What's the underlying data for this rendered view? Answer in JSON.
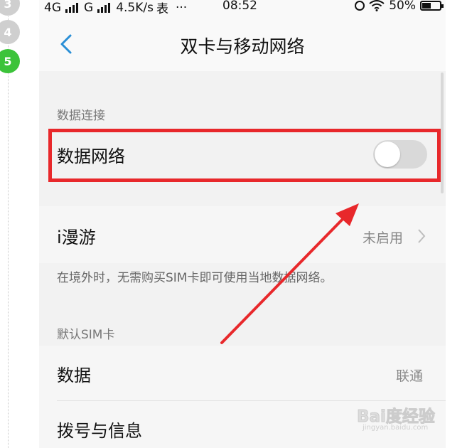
{
  "steps": {
    "s3": "3",
    "s4": "4",
    "s5": "5"
  },
  "status_bar": {
    "sim1": "4G",
    "sim2": "G",
    "speed": "4.5K/s",
    "app_icon": "表",
    "more": "···",
    "time": "08:52",
    "battery": "50%",
    "icons": [
      "alarm-icon",
      "wifi-icon",
      "battery-icon"
    ]
  },
  "navbar": {
    "title": "双卡与移动网络",
    "back_icon": "chevron-left-icon"
  },
  "data_connection": {
    "section_label": "数据连接",
    "data_network_label": "数据网络",
    "data_network_enabled": false
  },
  "roaming": {
    "label": "i漫游",
    "value": "未启用",
    "description": "在境外时，无需购买SIM卡即可使用当地数据网络。"
  },
  "default_sim": {
    "section_label": "默认SIM卡",
    "data_label": "数据",
    "data_value": "联通",
    "dial_label": "拨号与信息"
  },
  "watermark": {
    "main": "Bai度经验",
    "sub": "jingyan.baidu.com"
  },
  "colors": {
    "highlight": "#e8282b",
    "accent": "#2a8fd6",
    "step_active": "#3cc33a"
  }
}
